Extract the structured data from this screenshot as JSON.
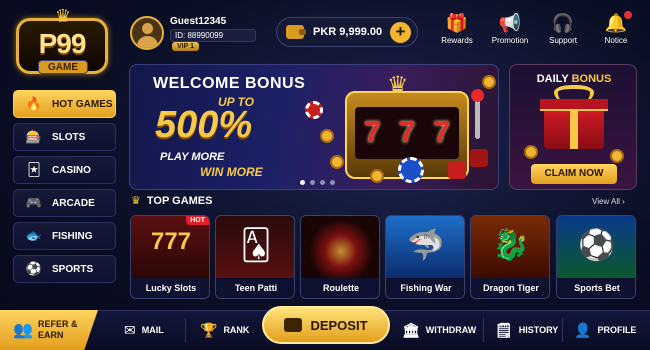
{
  "brand": {
    "logo_main": "P99",
    "logo_sub": "GAME"
  },
  "user": {
    "name": "Guest12345",
    "id": "ID: 88990099",
    "vip": "VIP 1"
  },
  "balance": {
    "amount": "PKR 9,999.00",
    "add": "+"
  },
  "topnav": [
    {
      "label": "Rewards",
      "icon": "gift-icon"
    },
    {
      "label": "Promotion",
      "icon": "megaphone-icon"
    },
    {
      "label": "Support",
      "icon": "headset-icon"
    },
    {
      "label": "Notice",
      "icon": "bell-icon"
    }
  ],
  "sidebar": [
    {
      "label": "HOT GAMES",
      "icon": "fire-icon"
    },
    {
      "label": "SLOTS",
      "icon": "slot-machine-icon"
    },
    {
      "label": "CASINO",
      "icon": "cards-icon"
    },
    {
      "label": "ARCADE",
      "icon": "gamepad-icon"
    },
    {
      "label": "FISHING",
      "icon": "fish-icon"
    },
    {
      "label": "SPORTS",
      "icon": "soccer-ball-icon"
    }
  ],
  "banner": {
    "title": "WELCOME BONUS",
    "upto": "UP TO",
    "percent": "500%",
    "line1": "PLAY MORE",
    "line2": "WIN MORE",
    "reels": [
      "7",
      "7",
      "7"
    ]
  },
  "daily": {
    "title_a": "DAILY ",
    "title_b": "BONUS",
    "claim": "CLAIM NOW"
  },
  "top_games": {
    "title": "TOP GAMES",
    "view_all": "View All",
    "hot_badge": "HOT",
    "games": [
      {
        "label": "Lucky Slots",
        "icon": "slot-777-icon"
      },
      {
        "label": "Teen Patti",
        "icon": "playing-cards-icon"
      },
      {
        "label": "Roulette",
        "icon": "roulette-wheel-icon"
      },
      {
        "label": "Fishing War",
        "icon": "shark-icon"
      },
      {
        "label": "Dragon Tiger",
        "icon": "dragon-icon"
      },
      {
        "label": "Sports Bet",
        "icon": "soccer-ball-icon"
      }
    ]
  },
  "bottom": {
    "refer": "REFER & EARN",
    "mail": "MAIL",
    "rank": "RANK",
    "deposit": "DEPOSIT",
    "withdraw": "WITHDRAW",
    "history": "HISTORY",
    "profile": "PROFILE"
  },
  "colors": {
    "accent": "#f7c948",
    "button_gold": "#e39f1d",
    "background": "#0b0f26",
    "notify": "#e53030"
  }
}
